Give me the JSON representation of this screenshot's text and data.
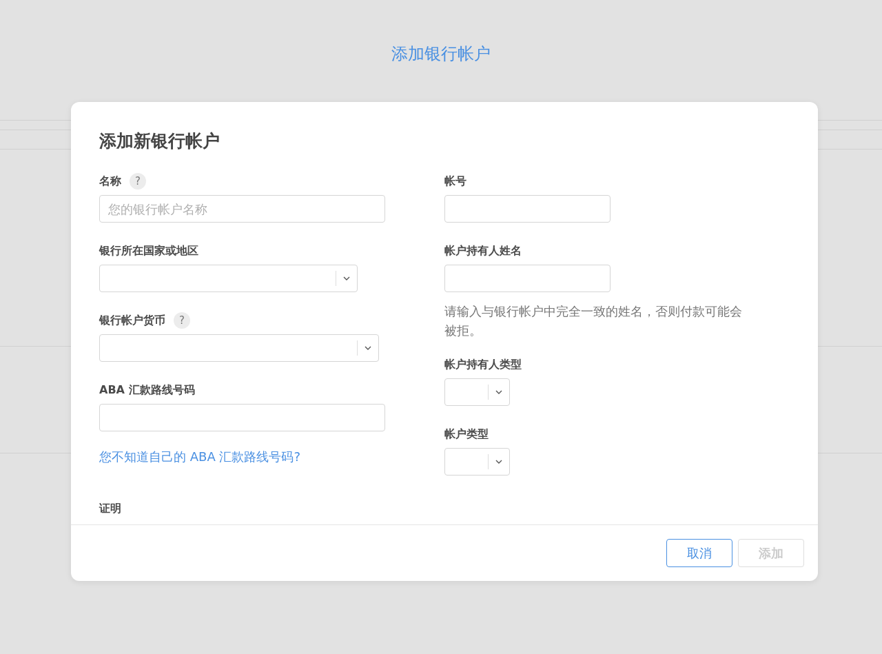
{
  "page": {
    "title": "添加银行帐户"
  },
  "dialog": {
    "title": "添加新银行帐户",
    "left_fields": [
      {
        "label": "名称",
        "help": "?",
        "kind": "text",
        "placeholder": "您的银行帐户名称"
      },
      {
        "label": "银行所在国家或地区",
        "kind": "select"
      },
      {
        "label": "银行帐户货币",
        "help": "?",
        "kind": "select"
      },
      {
        "label": "ABA 汇款路线号码",
        "kind": "text"
      }
    ],
    "aba_link": "您不知道自己的 ABA 汇款路线号码?",
    "right_fields": [
      {
        "label": "帐号",
        "kind": "text"
      },
      {
        "label": "帐户持有人姓名",
        "kind": "text",
        "hint": "请输入与银行帐户中完全一致的姓名，否则付款可能会被拒。"
      },
      {
        "label": "帐户持有人类型",
        "kind": "select"
      },
      {
        "label": "帐户类型",
        "kind": "select"
      }
    ],
    "proof_label": "证明",
    "buttons": [
      {
        "label": "取消",
        "disabled": false
      },
      {
        "label": "添加",
        "disabled": true
      }
    ]
  }
}
